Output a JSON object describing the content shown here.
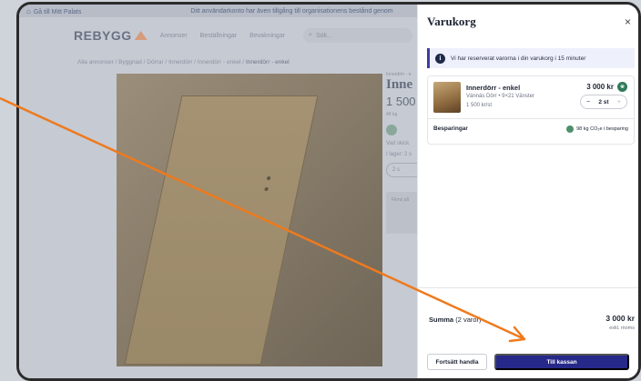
{
  "background_page": {
    "topbar": {
      "back_link": "Gå till Mitt Palats",
      "notice": "Ditt användarkonto har även tillgång till organisationens bestånd genom"
    },
    "nav": {
      "logo": "REBYGG",
      "links": [
        "Annonser",
        "Beställningar",
        "Bevakningar"
      ],
      "search_placeholder": "Sök..."
    },
    "breadcrumb": "Alla annonser / Byggnad / Dörrar / Innerdörr / Innerdörr - enkel / ",
    "breadcrumb_current": "Innerdörr - enkel",
    "detail": {
      "category": "Innerdörr - e",
      "title": "Inne",
      "price": "1 500",
      "co2": "49 kg",
      "condition": "Vad skick",
      "stock": "I lager: 2 s",
      "qty": "2 s",
      "finns": "Finns på"
    }
  },
  "drawer": {
    "title": "Varukorg",
    "close": "×",
    "notice": "Vi har reserverat varorna i din varukorg i 15 minuter",
    "item": {
      "name": "Innerdörr - enkel",
      "sub": "Vännäs Dörr • 9×21 Vänster",
      "unit_price": "1 500 kr/st",
      "price": "3 000 kr",
      "quantity": "2 st",
      "minus": "−",
      "plus": "+"
    },
    "savings_label": "Besparingar",
    "savings_value": "98 kg CO₂e i besparing",
    "sum_label": "Summa",
    "sum_count": "(2 varor)",
    "sum_value": "3 000 kr",
    "sum_note": "exkl. moms",
    "continue_button": "Fortsätt handla",
    "checkout_button": "Till kassan"
  },
  "colors": {
    "accent": "#27298a",
    "annotation_arrow": "#ee7a1e",
    "eco_badge": "#2f7a59"
  }
}
